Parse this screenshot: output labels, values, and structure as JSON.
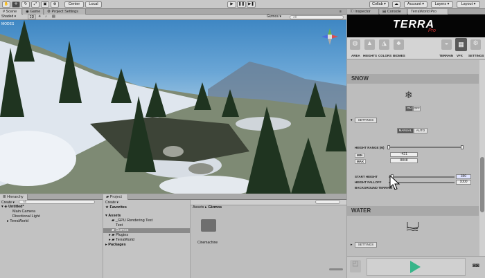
{
  "toolbar": {
    "pivot_label": "Center",
    "space_label": "Local",
    "collab_label": "Collab ▾",
    "account_label": "Account ▾",
    "layers_label": "Layers ▾",
    "layout_label": "Layout ▾"
  },
  "scene_tabs": [
    "Scene",
    "Game",
    "Project Settings"
  ],
  "scene_controls": {
    "shading": "Shaded",
    "mode_2d": "2D",
    "gizmos": "Gizmos ▾",
    "search_placeholder": "All"
  },
  "overlay_label": "MODES",
  "hierarchy": {
    "tab": "Hierarchy",
    "create_label": "Create ▾",
    "search_placeholder": "All",
    "scene_name": "Untitled*",
    "items": [
      "Main Camera",
      "Directional Light",
      "TerraWorld"
    ]
  },
  "project": {
    "tab": "Project",
    "create_label": "Create ▾",
    "favorites": "Favorites",
    "tree": [
      "Assets",
      "_GPU Rendering Test",
      "Test",
      "Gizmos",
      "Plugins",
      "TerraWorld",
      "Packages"
    ],
    "breadcrumb_root": "Assets",
    "breadcrumb_current": "Gizmos",
    "file_name": "Cinemachine"
  },
  "inspector": {
    "tabs": [
      "Inspector",
      "Console",
      "TerraWorld Pro"
    ],
    "logo": "TERRA",
    "logo_sub": "Pro",
    "nav_left": [
      "AREA",
      "HEIGHTS",
      "COLORS",
      "BIOMES"
    ],
    "nav_right": [
      "TERRAIN",
      "VFX",
      "SETTINGS"
    ],
    "snow": {
      "title": "SNOW",
      "on_label": "ON",
      "off_label": "OFF",
      "settings_label": "SETTINGS",
      "manual_label": "MANUAL",
      "auto_label": "AUTO",
      "height_range_label": "HEIGHT RANGE (M)",
      "min_label": "MIN",
      "min_value": "-421",
      "max_label": "MAX",
      "max_value": "8848",
      "start_height_label": "START HEIGHT",
      "start_height_value": "350",
      "height_falloff_label": "HEIGHT FALLOFF",
      "height_falloff_value": "1000",
      "background_terrain_label": "BACKGROUND TERRAIN"
    },
    "water": {
      "title": "WATER",
      "settings_label": "SETTINGS"
    }
  }
}
